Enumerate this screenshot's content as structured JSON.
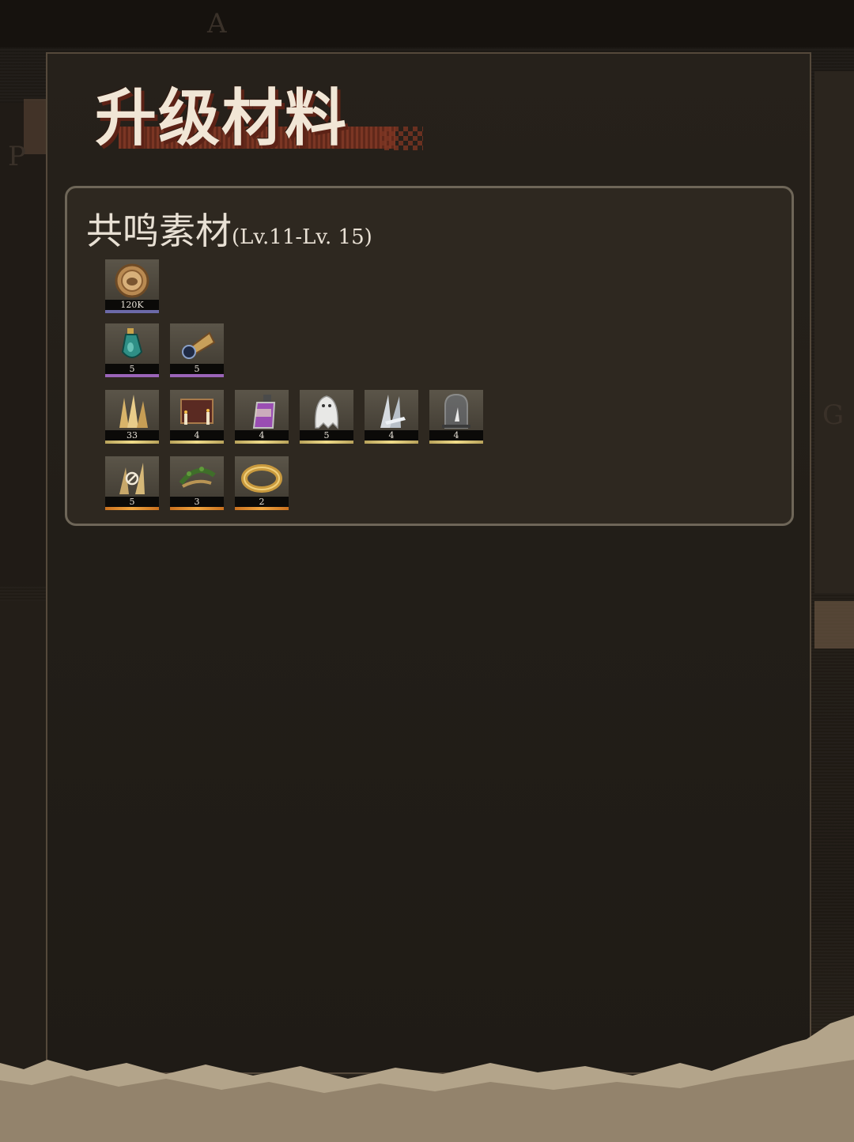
{
  "header": {
    "title": "升级材料"
  },
  "panel": {
    "title": "共鸣素材",
    "subtitle": "(Lv.11-Lv. 15)"
  },
  "rows": [
    [
      {
        "name": "gold-medal-coin",
        "count": "120K",
        "rarity": "blue"
      }
    ],
    [
      {
        "name": "teal-flask-vial",
        "count": "5",
        "rarity": "purple"
      },
      {
        "name": "gramophone-horn",
        "count": "5",
        "rarity": "purple"
      }
    ],
    [
      {
        "name": "golden-crystal-cluster",
        "count": "33",
        "rarity": "gold"
      },
      {
        "name": "candle-book-tome",
        "count": "4",
        "rarity": "gold"
      },
      {
        "name": "purple-potion-bottle",
        "count": "4",
        "rarity": "gold"
      },
      {
        "name": "white-ghost-cloth",
        "count": "5",
        "rarity": "gold"
      },
      {
        "name": "silver-blades",
        "count": "4",
        "rarity": "gold"
      },
      {
        "name": "glass-bell-jar",
        "count": "4",
        "rarity": "gold"
      }
    ],
    [
      {
        "name": "gilded-spikes",
        "count": "5",
        "rarity": "orange"
      },
      {
        "name": "laurel-wreath",
        "count": "3",
        "rarity": "orange"
      },
      {
        "name": "golden-ring",
        "count": "2",
        "rarity": "orange"
      }
    ]
  ]
}
